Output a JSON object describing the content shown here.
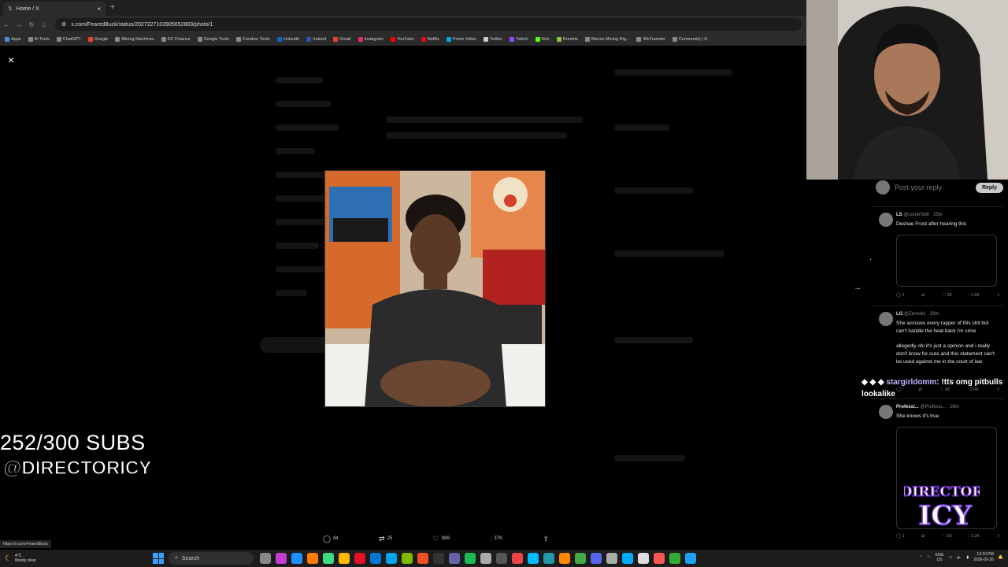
{
  "browser": {
    "tab_title": "Home / X",
    "new_tab": "+",
    "url": "x.com/FearedBuck/status/2027227103905652883/photo/1",
    "bookmarks": [
      {
        "label": "Apps",
        "color": "#4a90e2"
      },
      {
        "label": "Ai Tools",
        "color": "#888888"
      },
      {
        "label": "ChatGPT",
        "color": "#888888"
      },
      {
        "label": "Google",
        "color": "#ea4335"
      },
      {
        "label": "Mining Machines",
        "color": "#888888"
      },
      {
        "label": "DC Finance",
        "color": "#888888"
      },
      {
        "label": "Google Tools",
        "color": "#888888"
      },
      {
        "label": "Creative Tools",
        "color": "#888888"
      },
      {
        "label": "LinkedIn",
        "color": "#0a66c2"
      },
      {
        "label": "Indeed",
        "color": "#2557a7"
      },
      {
        "label": "Gmail",
        "color": "#ea4335"
      },
      {
        "label": "Instagram",
        "color": "#e1306c"
      },
      {
        "label": "YouTube",
        "color": "#ff0000"
      },
      {
        "label": "Netflix",
        "color": "#e50914"
      },
      {
        "label": "Prime Video",
        "color": "#00a8e1"
      },
      {
        "label": "Twitter",
        "color": "#cccccc"
      },
      {
        "label": "Twitch",
        "color": "#9146ff"
      },
      {
        "label": "Kick",
        "color": "#53fc18"
      },
      {
        "label": "Rumble",
        "color": "#85c742"
      },
      {
        "label": "Bitcoin Mining Rig...",
        "color": "#888888"
      },
      {
        "label": "WeTransfer",
        "color": "#888888"
      },
      {
        "label": "Community | G",
        "color": "#888888"
      }
    ]
  },
  "viewer": {
    "close_icon": "×",
    "next_icon": "→",
    "actions": [
      {
        "icon": "reply-icon",
        "glyph": "◯",
        "count": "84"
      },
      {
        "icon": "retweet-icon",
        "glyph": "⇄",
        "count": "25"
      },
      {
        "icon": "like-icon",
        "glyph": "♡",
        "count": "989"
      },
      {
        "icon": "views-icon",
        "glyph": "⫶",
        "count": "37K"
      },
      {
        "icon": "share-icon",
        "glyph": "⇪",
        "count": ""
      }
    ]
  },
  "status_url": "https://x.com/FearedBuck",
  "overlay": {
    "subs": "252/300 SUBS",
    "handle": "@DIRECTORICY"
  },
  "replies": {
    "placeholder": "Post your reply",
    "reply_button": "Reply",
    "tweets": [
      {
        "name": "LS",
        "handle": "@LonerSkill · 25m",
        "text": "Deshae Frost after hearing this",
        "stats": [
          "1",
          "",
          "28",
          "1.6K",
          ""
        ]
      },
      {
        "name": "LG",
        "handle": "@Zentotic · 29m",
        "text": "She accuses every rapper of this shit but can't handle the heat back i'm crine",
        "text2": "allegedly ofc it's just a opinion and i really don't know for sure and this statement can't be used against me in the court of law",
        "stats": [
          "",
          "",
          "43",
          "2.6K",
          ""
        ]
      },
      {
        "name": "Professi...",
        "handle": "@Professi... · 29m",
        "text": "She knows it's true",
        "stats": [
          "1",
          "",
          "58",
          "3.2K",
          ""
        ]
      }
    ]
  },
  "chat": {
    "user": "stargirldomm",
    "message": ": !tts omg pitbulls lookalike"
  },
  "logo_text": {
    "line1": "DIRECTOR",
    "line2": "ICY"
  },
  "taskbar": {
    "weather_temp": "4°C",
    "weather_desc": "Mostly clear",
    "search": "Search",
    "lang1": "ENG",
    "lang2": "US",
    "time": "13:10 PM",
    "date": "2026-02-26"
  }
}
